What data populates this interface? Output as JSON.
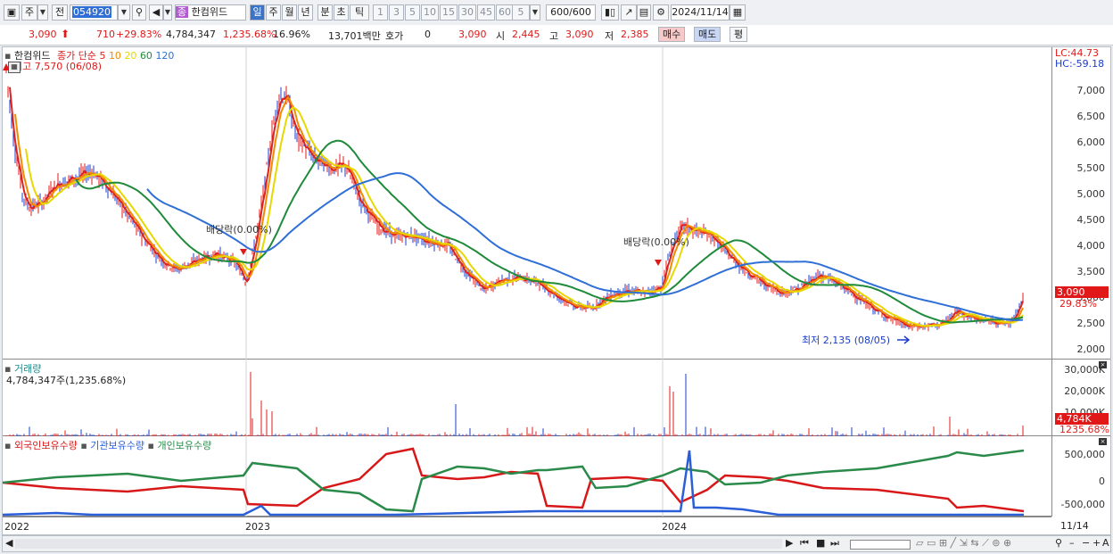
{
  "toolbar": {
    "period_type": "주",
    "prev_label": "전",
    "code": "054920",
    "stock_badge": "종",
    "stock_name": "한컴위드",
    "periods": [
      "일",
      "주",
      "월",
      "년",
      "분",
      "초",
      "틱"
    ],
    "minutes": [
      "1",
      "3",
      "5",
      "10",
      "15",
      "30",
      "45",
      "60"
    ],
    "custom_minute": "5",
    "count": "600/600",
    "date": "2024/11/14"
  },
  "quote": {
    "price": "3,090",
    "change": "710",
    "change_pct": "+29.83%",
    "volume": "4,784,347",
    "volume_pct": "1,235.68%",
    "turnover_pct": "16.96%",
    "amount": "13,701백만",
    "hoga_label": "호가",
    "hoga_value": "0",
    "current": "3,090",
    "open_label": "시",
    "open": "2,445",
    "high_label": "고",
    "high": "3,090",
    "low_label": "저",
    "low": "2,385",
    "buy_label": "매수",
    "sell_label": "매도",
    "eval_label": "평"
  },
  "price_panel": {
    "name": "한컴위드",
    "indicator": "종가 단순",
    "ma": [
      {
        "period": "5",
        "color": "#e02020"
      },
      {
        "period": "10",
        "color": "#f08c00"
      },
      {
        "period": "20",
        "color": "#e6d800"
      },
      {
        "period": "60",
        "color": "#1f8a3a"
      },
      {
        "period": "120",
        "color": "#2f6fd6"
      }
    ],
    "high_note": "최고 7,570 (06/08)",
    "low_note": "최저 2,135 (08/05)",
    "dividend_note": "배당락(0.00%)",
    "lc": "LC:44.73",
    "hc": "HC:-59.18",
    "current_tag": "3,090",
    "current_pct": "29.83%",
    "y_ticks": [
      "7,000",
      "6,500",
      "6,000",
      "5,500",
      "5,000",
      "4,500",
      "4,000",
      "3,500",
      "3,000",
      "2,500",
      "2,000"
    ]
  },
  "volume_panel": {
    "title": "거래량",
    "info": "4,784,347주(1,235.68%)",
    "y_ticks": [
      "30,000K",
      "20,000K",
      "10,000K"
    ],
    "current_tag": "4,784K",
    "current_pct": "1235.68%"
  },
  "holding_panel": {
    "series": [
      {
        "name": "외국인보유수량",
        "color": "#d81818"
      },
      {
        "name": "기관보유수량",
        "color": "#2a5fd8"
      },
      {
        "name": "개인보유수량",
        "color": "#2a8a4a"
      }
    ],
    "y_ticks": [
      "500,000",
      "0",
      "-500,000"
    ]
  },
  "x_axis": {
    "labels": [
      "2022",
      "2023",
      "2024"
    ],
    "last_date": "11/14"
  },
  "colors": {
    "up": "#e01818",
    "down": "#1a3cc8",
    "accent": "#3b73c9"
  }
}
